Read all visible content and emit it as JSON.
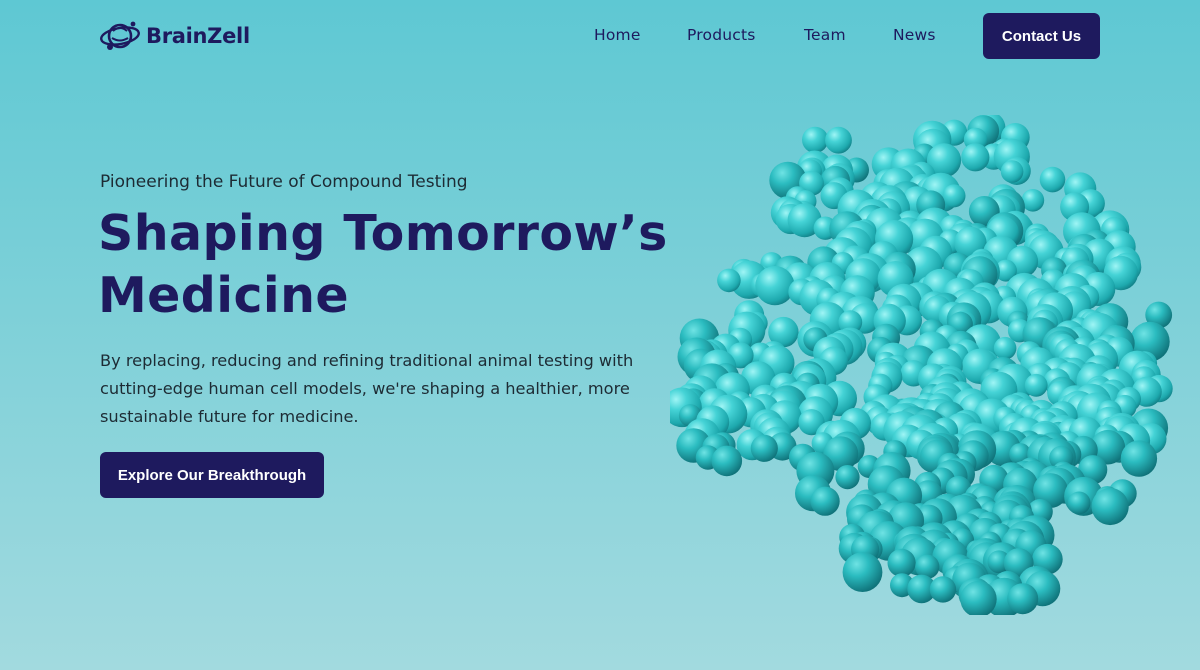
{
  "brand": {
    "name": "BrainZell",
    "logo_icon": "brain-orbit-logo-icon"
  },
  "nav": {
    "items": [
      {
        "label": "Home"
      },
      {
        "label": "Products"
      },
      {
        "label": "Team"
      },
      {
        "label": "News"
      }
    ],
    "contact_label": "Contact Us"
  },
  "hero": {
    "eyebrow": "Pioneering the Future of Compound Testing",
    "title_line1": "Shaping Tomorrow’s",
    "title_line2": "Medicine",
    "description": "By replacing, reducing and refining traditional animal testing with cutting-edge human cell models, we're shaping a healthier, more sustainable future for medicine.",
    "cta_label": "Explore Our Breakthrough",
    "illustration": "protein-molecule-3d-illustration"
  },
  "colors": {
    "brand_navy": "#1e1a5e",
    "background_top": "#5ec8d3",
    "background_bottom": "#a2dadf",
    "molecule": "#38c6cc"
  }
}
